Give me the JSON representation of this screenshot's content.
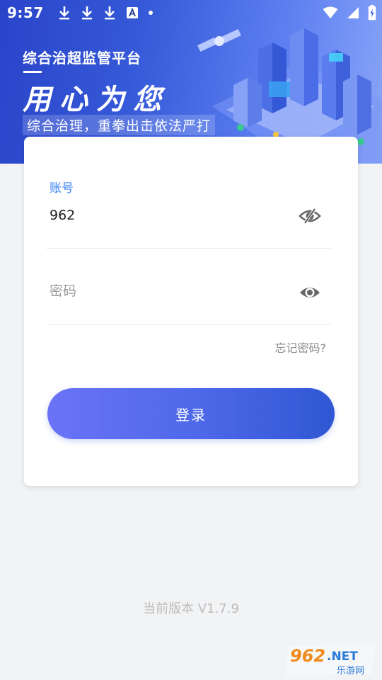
{
  "status_bar": {
    "time": "9:57",
    "icons": [
      "download-icon",
      "download-icon",
      "download-icon",
      "font-a-icon",
      "dot-icon",
      "wifi-icon",
      "signal-icon",
      "battery-charging-icon"
    ]
  },
  "banner": {
    "title": "综合治超监管平台",
    "slogan": "用心为您",
    "subtitle": "综合治理，重拳出击依法严打"
  },
  "login": {
    "account_label": "账号",
    "account_value": "962",
    "password_placeholder": "密码",
    "forgot_label": "忘记密码?",
    "login_button": "登录"
  },
  "version": "当前版本 V1.7.9",
  "watermark": {
    "brand": "962.NET",
    "sub": "乐游网"
  },
  "colors": {
    "accent": "#3b82f6",
    "button_start": "#6b73f7",
    "button_end": "#2f57d4",
    "background": "#f2f3f5"
  }
}
